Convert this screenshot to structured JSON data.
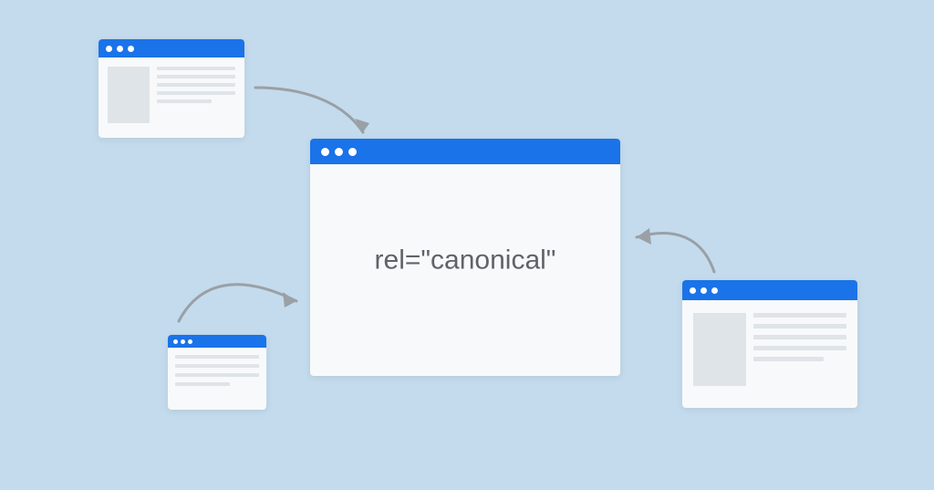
{
  "diagram": {
    "center_label": "rel=\"canonical\"",
    "concept": "canonical-url-relationship",
    "colors": {
      "background": "#c3dbed",
      "accent": "#1a73e8",
      "window_bg": "#f8f9fa",
      "placeholder": "#dfe4e8",
      "arrow": "#9aa0a6",
      "text": "#5f6368"
    },
    "windows": {
      "top_left": {
        "role": "duplicate-page",
        "has_thumbnail": true,
        "line_count": 5
      },
      "bottom_left": {
        "role": "duplicate-page",
        "has_thumbnail": false,
        "line_count": 4
      },
      "right": {
        "role": "duplicate-page",
        "has_thumbnail": true,
        "line_count": 5
      },
      "center": {
        "role": "canonical-page"
      }
    }
  }
}
